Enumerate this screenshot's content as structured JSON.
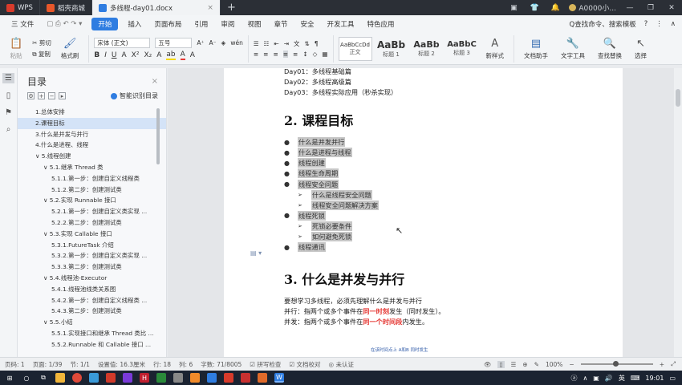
{
  "titlebar": {
    "tabs": [
      {
        "label": "WPS"
      },
      {
        "label": "稻壳商城"
      },
      {
        "label": "多线程-day01.docx"
      }
    ],
    "user": "A0000小..."
  },
  "menu": {
    "file": "三 文件",
    "items": [
      "开始",
      "插入",
      "页面布局",
      "引用",
      "审阅",
      "视图",
      "章节",
      "安全",
      "开发工具",
      "特色应用"
    ],
    "search": "Q查找命令、搜索模板"
  },
  "ribbon": {
    "paste": "粘贴",
    "cut": "剪切",
    "copy": "复制",
    "format_painter": "格式刷",
    "font": "宋体 (正文)",
    "size": "五号",
    "styles": [
      {
        "preview": "AaBbCcDd",
        "label": "正文"
      },
      {
        "preview": "AaBb",
        "label": "标题 1"
      },
      {
        "preview": "AaBb",
        "label": "标题 2"
      },
      {
        "preview": "AaBbC",
        "label": "标题 3"
      }
    ],
    "new_style": "新样式",
    "doc_assistant": "文档助手",
    "text_tools": "文字工具",
    "find_replace": "查找替换",
    "select": "选择"
  },
  "toc": {
    "title": "目录",
    "smart": "智能识别目录",
    "items": [
      {
        "label": "1.总体安排",
        "level": 1
      },
      {
        "label": "2.课程目标",
        "level": 1,
        "selected": true
      },
      {
        "label": "3.什么是并发与并行",
        "level": 1
      },
      {
        "label": "4.什么是进程、线程",
        "level": 1
      },
      {
        "label": "∨ 5.线程创建",
        "level": 1
      },
      {
        "label": "∨ 5.1.继承 Thread 类",
        "level": 2
      },
      {
        "label": "5.1.1.第一步：创建自定义线程类",
        "level": 3
      },
      {
        "label": "5.1.2.第二步：创建测试类",
        "level": 3
      },
      {
        "label": "∨ 5.2.实现 Runnable 接口",
        "level": 2
      },
      {
        "label": "5.2.1.第一步：创建自定义类实现 ...",
        "level": 3
      },
      {
        "label": "5.2.2.第二步：创建测试类",
        "level": 3
      },
      {
        "label": "∨ 5.3.实现 Callable 接口",
        "level": 2
      },
      {
        "label": "5.3.1.FutureTask 介绍",
        "level": 3
      },
      {
        "label": "5.3.2.第一步：创建自定义类实现 ...",
        "level": 3
      },
      {
        "label": "5.3.3.第二步：创建测试类",
        "level": 3
      },
      {
        "label": "∨ 5.4.线程池-Executor",
        "level": 2
      },
      {
        "label": "5.4.1.线程池线类关系图",
        "level": 3
      },
      {
        "label": "5.4.2.第一步：创建自定义线程类 ...",
        "level": 3
      },
      {
        "label": "5.4.3.第二步：创建测试类",
        "level": 3
      },
      {
        "label": "∨ 5.5.小结",
        "level": 2
      },
      {
        "label": "5.5.1.实现接口和继承 Thread 类比 ...",
        "level": 3
      },
      {
        "label": "5.5.2.Runnable 和 Callable 接口 ...",
        "level": 3
      }
    ]
  },
  "doc": {
    "lines_top": [
      "Day01：多线程基础篇",
      "Day02：多线程高级篇",
      "Day03：多线程实际应用（秒杀实现）"
    ],
    "h_goal": "2. 课程目标",
    "bullets": [
      {
        "text": "什么是并发并行",
        "level": 1
      },
      {
        "text": "什么是进程与线程",
        "level": 1
      },
      {
        "text": "线程创建",
        "level": 1
      },
      {
        "text": "线程生命周期",
        "level": 1
      },
      {
        "text": "线程安全问题",
        "level": 1
      },
      {
        "text": "什么是线程安全问题",
        "level": 2
      },
      {
        "text": "线程安全问题解决方案",
        "level": 2
      },
      {
        "text": "线程死锁",
        "level": 1
      },
      {
        "text": "死锁必要条件",
        "level": 2
      },
      {
        "text": "如何避免死锁",
        "level": 2
      },
      {
        "text": "线程通讯",
        "level": 1
      }
    ],
    "h_concurrency": "3. 什么是并发与并行",
    "intro": "要想学习多线程，必须先理解什么是并发与并行",
    "parallel_pre": "并行：指两个或多个事件在",
    "parallel_hl": "同一时刻",
    "parallel_post": "发生（同时发生）。",
    "concurrent_pre": "并发：指两个或多个事件在",
    "concurrent_hl": "同一个时间段",
    "concurrent_post": "内发生。",
    "figure_caption": "在该时间点上 A和B 同时发生"
  },
  "status": {
    "page_num": "页码: 1",
    "pages": "页面: 1/39",
    "section": "节: 1/1",
    "setting": "设置值: 16.3厘米",
    "row": "行: 18",
    "col": "列: 6",
    "words": "字数: 71/8005",
    "spell": "拼写检查",
    "proof": "文档校对",
    "cert": "未认证",
    "zoom": "100%"
  },
  "taskbar": {
    "time": "19:01",
    "lang": "英"
  }
}
